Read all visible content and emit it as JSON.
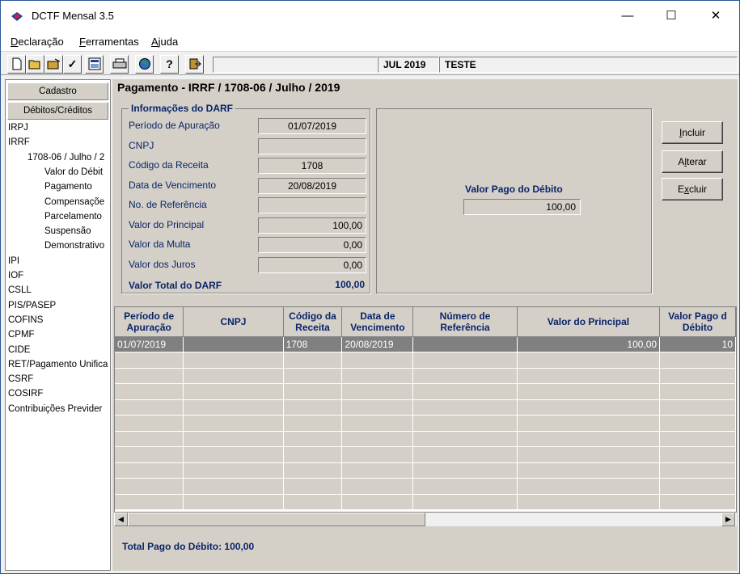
{
  "window": {
    "title": "DCTF Mensal 3.5",
    "minimize": "—",
    "maximize": "☐",
    "close": "✕"
  },
  "menu": [
    {
      "label": "Declaração",
      "accel": "D",
      "rest": "eclaração"
    },
    {
      "label": "Ferramentas",
      "accel": "F",
      "rest": "erramentas"
    },
    {
      "label": "Ajuda",
      "accel": "A",
      "rest": "juda"
    }
  ],
  "toolbar": {
    "period": "JUL 2019",
    "name": "TESTE",
    "icons": [
      "new-file-icon",
      "open-folder-icon",
      "open-icon",
      "check-icon",
      "calculator-icon",
      "print-icon",
      "globe-icon",
      "help-icon",
      "exit-icon"
    ]
  },
  "left_nav": {
    "cadastro": "Cadastro",
    "debitos": "Débitos/Créditos",
    "tree": [
      {
        "label": "IRPJ",
        "level": 0
      },
      {
        "label": "IRRF",
        "level": 0
      },
      {
        "label": "1708-06 / Julho / 2",
        "level": 1
      },
      {
        "label": "Valor do Débit",
        "level": 2
      },
      {
        "label": "Pagamento",
        "level": 2
      },
      {
        "label": "Compensaçõe",
        "level": 2
      },
      {
        "label": "Parcelamento",
        "level": 2
      },
      {
        "label": "Suspensão",
        "level": 2
      },
      {
        "label": "Demonstrativo",
        "level": 2
      },
      {
        "label": "IPI",
        "level": 0
      },
      {
        "label": "IOF",
        "level": 0
      },
      {
        "label": "CSLL",
        "level": 0
      },
      {
        "label": "PIS/PASEP",
        "level": 0
      },
      {
        "label": "COFINS",
        "level": 0
      },
      {
        "label": "CPMF",
        "level": 0
      },
      {
        "label": "CIDE",
        "level": 0
      },
      {
        "label": "RET/Pagamento Unifica",
        "level": 0
      },
      {
        "label": "CSRF",
        "level": 0
      },
      {
        "label": "COSIRF",
        "level": 0
      },
      {
        "label": "Contribuições Previder",
        "level": 0
      }
    ]
  },
  "main": {
    "title": "Pagamento - IRRF / 1708-06 / Julho / 2019",
    "darf": {
      "legend": "Informações do DARF",
      "fields": [
        {
          "label": "Período de Apuração",
          "value": "01/07/2019",
          "align": "center"
        },
        {
          "label": "CNPJ",
          "value": "",
          "align": "center"
        },
        {
          "label": "Código da Receita",
          "value": "1708",
          "align": "center"
        },
        {
          "label": "Data de Vencimento",
          "value": "20/08/2019",
          "align": "center"
        },
        {
          "label": "No. de Referência",
          "value": "",
          "align": "center"
        },
        {
          "label": "Valor do Principal",
          "value": "100,00",
          "align": "right"
        },
        {
          "label": "Valor da Multa",
          "value": "0,00",
          "align": "right"
        },
        {
          "label": "Valor dos Juros",
          "value": "0,00",
          "align": "right"
        }
      ],
      "total_label": "Valor Total do DARF",
      "total_value": "100,00"
    },
    "valor_pago": {
      "label": "Valor Pago do Débito",
      "value": "100,00"
    },
    "buttons": {
      "incluir": "Incluir",
      "alterar": "Alterar",
      "excluir": "Excluir"
    },
    "grid": {
      "columns": [
        {
          "l1": "Período de",
          "l2": "Apuração"
        },
        {
          "l1": "CNPJ",
          "l2": ""
        },
        {
          "l1": "Código da",
          "l2": "Receita"
        },
        {
          "l1": "Data de",
          "l2": "Vencimento"
        },
        {
          "l1": "Número de",
          "l2": "Referência"
        },
        {
          "l1": "Valor do Principal",
          "l2": ""
        },
        {
          "l1": "Valor Pago d",
          "l2": "Débito"
        }
      ],
      "rows": [
        [
          "01/07/2019",
          "",
          "1708",
          "20/08/2019",
          "",
          "100,00",
          "10"
        ]
      ],
      "empty_rows": 10
    },
    "footer_total": "Total Pago do Débito:  100,00"
  }
}
